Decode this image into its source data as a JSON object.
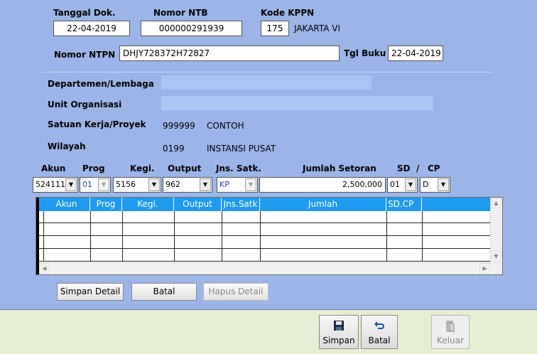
{
  "header": {
    "tanggal_dok_label": "Tanggal Dok.",
    "tanggal_dok_value": "22-04-2019",
    "nomor_ntb_label": "Nomor  NTB",
    "nomor_ntb_value": "000000291939",
    "kode_kppn_label": "Kode KPPN",
    "kode_kppn_value": "175",
    "kppn_name": "JAKARTA VI",
    "nomor_ntpn_label": "Nomor  NTPN",
    "nomor_ntpn_value": "DHJY728372H72827",
    "tgl_buku_label": "Tgl Buku",
    "tgl_buku_value": "22-04-2019"
  },
  "info": {
    "departemen_label": "Departemen/Lembaga",
    "unit_label": "Unit Organisasi",
    "satker_label": "Satuan Kerja/Proyek",
    "satker_code": "999999",
    "satker_name": "CONTOH",
    "wilayah_label": "Wilayah",
    "wilayah_code": "0199",
    "wilayah_name": "INSTANSI PUSAT"
  },
  "entry": {
    "akun_label": "Akun",
    "prog_label": "Prog",
    "kegi_label": "Kegi.",
    "output_label": "Output",
    "jns_satk_label": "Jns. Satk.",
    "jumlah_label": "Jumlah Setoran",
    "sd_label": "SD",
    "slash": "/",
    "cp_label": "CP",
    "akun_value": "524111",
    "prog_value": "01",
    "kegi_value": "5156",
    "output_value": "962",
    "jns_satk_value": "KP",
    "jumlah_value": "2,500,000",
    "sd_value": "01",
    "cp_value": "D"
  },
  "grid": {
    "columns": [
      "Akun",
      "Prog",
      "Kegi.",
      "Output",
      "Jns.Satk",
      "Jumlah",
      "SD.CP"
    ]
  },
  "buttons": {
    "simpan_detail": "Simpan Detail",
    "batal": "Batal",
    "hapus_detail": "Hapus Detail"
  },
  "toolbar": {
    "simpan": "Simpan",
    "batal": "Batal",
    "keluar": "Keluar"
  },
  "colors": {
    "panel": "#9bb5e8",
    "footer": "#e6eed3",
    "grid_header": "#1e9bef"
  }
}
